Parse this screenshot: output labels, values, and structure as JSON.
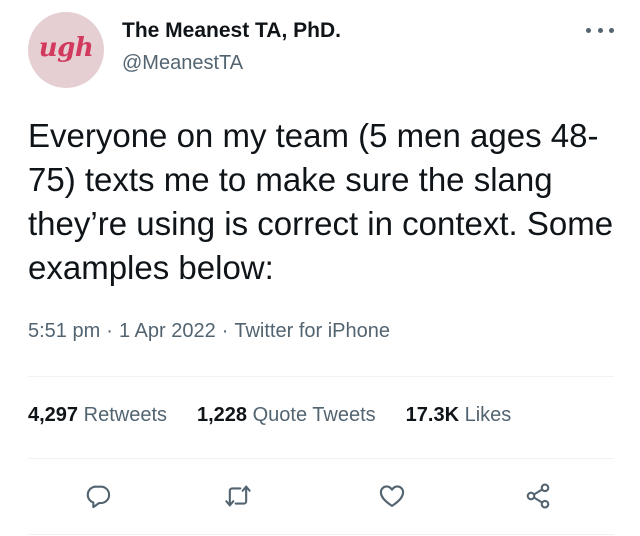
{
  "author": {
    "avatar_text": "ugh",
    "display_name": "The Meanest TA, PhD.",
    "handle": "@MeanestTA"
  },
  "tweet": {
    "text": "Everyone on my team (5 men ages 48-75) texts me to make sure the slang they’re using is correct in context. Some examples below:",
    "time": "5:51 pm",
    "separator": "·",
    "date": "1 Apr 2022",
    "source": "Twitter for iPhone"
  },
  "stats": {
    "retweets_count": "4,297",
    "retweets_label": "Retweets",
    "quotes_count": "1,228",
    "quotes_label": "Quote Tweets",
    "likes_count": "17.3K",
    "likes_label": "Likes"
  },
  "icons": {
    "more": "more-dots-icon",
    "reply": "reply-icon",
    "retweet": "retweet-icon",
    "like": "heart-icon",
    "share": "share-icon"
  },
  "colors": {
    "text_primary": "#0f1419",
    "text_secondary": "#536471",
    "divider": "#eff3f4",
    "avatar_bg": "#e6cfd3",
    "avatar_text": "#d13a5e"
  }
}
